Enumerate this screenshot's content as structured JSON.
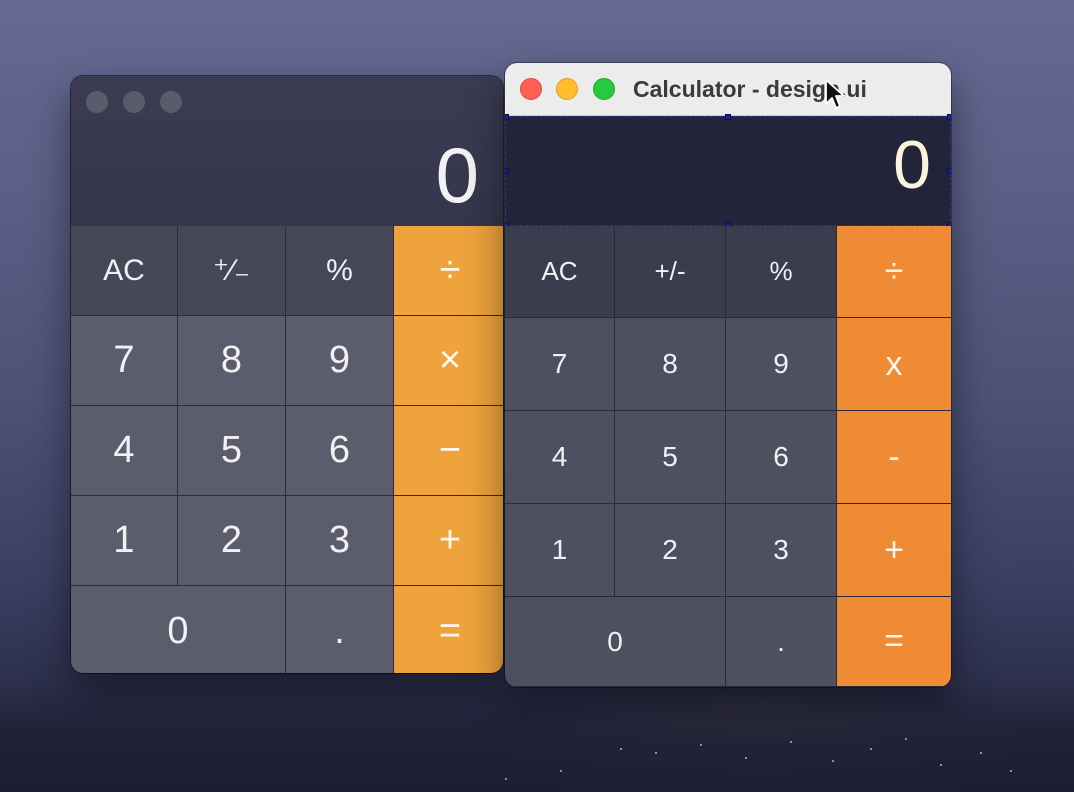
{
  "left_calculator": {
    "display": "0",
    "keys": [
      {
        "label": "AC",
        "kind": "fn"
      },
      {
        "label": "⁺∕₋",
        "kind": "fn"
      },
      {
        "label": "%",
        "kind": "fn"
      },
      {
        "label": "÷",
        "kind": "op"
      },
      {
        "label": "7",
        "kind": "num"
      },
      {
        "label": "8",
        "kind": "num"
      },
      {
        "label": "9",
        "kind": "num"
      },
      {
        "label": "×",
        "kind": "op"
      },
      {
        "label": "4",
        "kind": "num"
      },
      {
        "label": "5",
        "kind": "num"
      },
      {
        "label": "6",
        "kind": "num"
      },
      {
        "label": "−",
        "kind": "op"
      },
      {
        "label": "1",
        "kind": "num"
      },
      {
        "label": "2",
        "kind": "num"
      },
      {
        "label": "3",
        "kind": "num"
      },
      {
        "label": "+",
        "kind": "op"
      },
      {
        "label": "0",
        "kind": "num"
      },
      {
        "label": ".",
        "kind": "num"
      },
      {
        "label": "=",
        "kind": "op"
      }
    ]
  },
  "right_calculator": {
    "title": "Calculator - design.ui",
    "display": "0",
    "keys": [
      {
        "label": "AC",
        "kind": "fn"
      },
      {
        "label": "+/-",
        "kind": "fn"
      },
      {
        "label": "%",
        "kind": "fn"
      },
      {
        "label": "÷",
        "kind": "op"
      },
      {
        "label": "7",
        "kind": "num"
      },
      {
        "label": "8",
        "kind": "num"
      },
      {
        "label": "9",
        "kind": "num"
      },
      {
        "label": "x",
        "kind": "op"
      },
      {
        "label": "4",
        "kind": "num"
      },
      {
        "label": "5",
        "kind": "num"
      },
      {
        "label": "6",
        "kind": "num"
      },
      {
        "label": "-",
        "kind": "op"
      },
      {
        "label": "1",
        "kind": "num"
      },
      {
        "label": "2",
        "kind": "num"
      },
      {
        "label": "3",
        "kind": "num"
      },
      {
        "label": "+",
        "kind": "op"
      },
      {
        "label": "0",
        "kind": "num"
      },
      {
        "label": ".",
        "kind": "num"
      },
      {
        "label": "=",
        "kind": "op"
      }
    ]
  },
  "colors": {
    "operator_left": "#eea33c",
    "operator_right": "#ef8a35",
    "close": "#ff5f57",
    "minimize": "#febc2e",
    "zoom": "#28c840"
  },
  "icons": [
    "close-icon",
    "minimize-icon",
    "zoom-icon",
    "mouse-pointer-icon"
  ]
}
